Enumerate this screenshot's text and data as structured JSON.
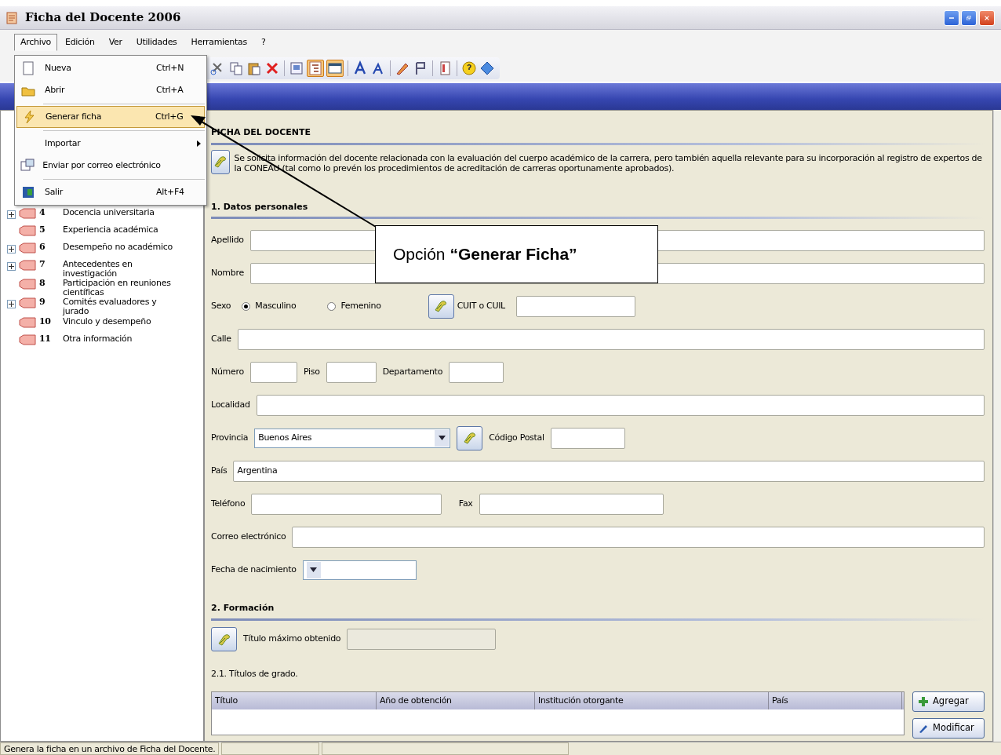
{
  "window": {
    "title": "Ficha del Docente 2006"
  },
  "menu_bar": [
    {
      "label": "Archivo",
      "selected": true
    },
    {
      "label": "Edición",
      "selected": false
    },
    {
      "label": "Ver",
      "selected": false
    },
    {
      "label": "Utilidades",
      "selected": false
    },
    {
      "label": "Herramientas",
      "selected": false
    },
    {
      "label": "?",
      "selected": false
    }
  ],
  "file_menu": [
    {
      "kind": "item",
      "label": "Nueva",
      "shortcut": "Ctrl+N",
      "selected": false
    },
    {
      "kind": "item",
      "label": "Abrir",
      "shortcut": "Ctrl+A",
      "selected": false
    },
    {
      "kind": "separator"
    },
    {
      "kind": "item",
      "label": "Generar ficha",
      "shortcut": "Ctrl+G",
      "selected": true
    },
    {
      "kind": "separator"
    },
    {
      "kind": "submenu",
      "label": "Importar",
      "selected": false
    },
    {
      "kind": "item",
      "label": "Enviar por correo electrónico",
      "selected": false
    },
    {
      "kind": "separator"
    },
    {
      "kind": "item",
      "label": "Salir",
      "shortcut": "Alt+F4",
      "selected": false
    }
  ],
  "tree": [
    {
      "number": "4",
      "label": "Docencia universitaria",
      "expandable": true
    },
    {
      "number": "5",
      "label": "Experiencia académica",
      "expandable": false
    },
    {
      "number": "6",
      "label": "Desempeño no académico",
      "expandable": true
    },
    {
      "number": "7",
      "label": "Antecedentes en investigación",
      "expandable": true
    },
    {
      "number": "8",
      "label": "Participación en reuniones científicas",
      "expandable": false
    },
    {
      "number": "9",
      "label": "Comités evaluadores y jurado",
      "expandable": true
    },
    {
      "number": "10",
      "label": "Vinculo y desempeño",
      "expandable": false
    },
    {
      "number": "11",
      "label": "Otra información",
      "expandable": false
    }
  ],
  "form": {
    "title": "FICHA DEL DOCENTE",
    "intro": "Se solicita información del docente relacionada con la evaluación del cuerpo académico de la carrera, pero también aquella relevante para su incorporación al registro de expertos de la CONEAU (tal como lo prevén los procedimientos de acreditación de carreras oportunamente aprobados).",
    "personal_heading": "1. Datos personales",
    "apellido": {
      "label": "Apellido"
    },
    "nombre": {
      "label": "Nombre"
    },
    "sexo": {
      "label": "Sexo",
      "options": [
        {
          "label": "Masculino",
          "selected": true
        },
        {
          "label": "Femenino",
          "selected": false
        }
      ]
    },
    "cuit": {
      "label": "CUIT o CUIL"
    },
    "calle": {
      "label": "Calle"
    },
    "numero": {
      "label": "Número"
    },
    "piso": {
      "label": "Piso"
    },
    "departamento": {
      "label": "Departamento"
    },
    "localidad": {
      "label": "Localidad"
    },
    "provincia": {
      "label": "Provincia",
      "value": "Buenos Aires"
    },
    "codigo_postal": {
      "label": "Código Postal"
    },
    "pais": {
      "label": "País",
      "value": "Argentina"
    },
    "telefono": {
      "label": "Teléfono"
    },
    "fax": {
      "label": "Fax"
    },
    "correo": {
      "label": "Correo electrónico"
    },
    "fecha_nacimiento": {
      "label": "Fecha de nacimiento"
    },
    "formacion_heading": "2. Formación",
    "titulo_maximo": {
      "label": "Título máximo obtenido",
      "disabled": true
    },
    "grado_heading": "2.1. Títulos de grado.",
    "table": {
      "columns": [
        "Título",
        "Año de obtención",
        "Institución otorgante",
        "País"
      ]
    },
    "buttons": [
      {
        "kind": "add",
        "label": "Agregar"
      },
      {
        "kind": "edit",
        "label": "Modificar"
      }
    ]
  },
  "callout": "Opción **“Generar Ficha”**",
  "status_bar": {
    "text": "Genera la ficha en un archivo de Ficha del Docente."
  }
}
